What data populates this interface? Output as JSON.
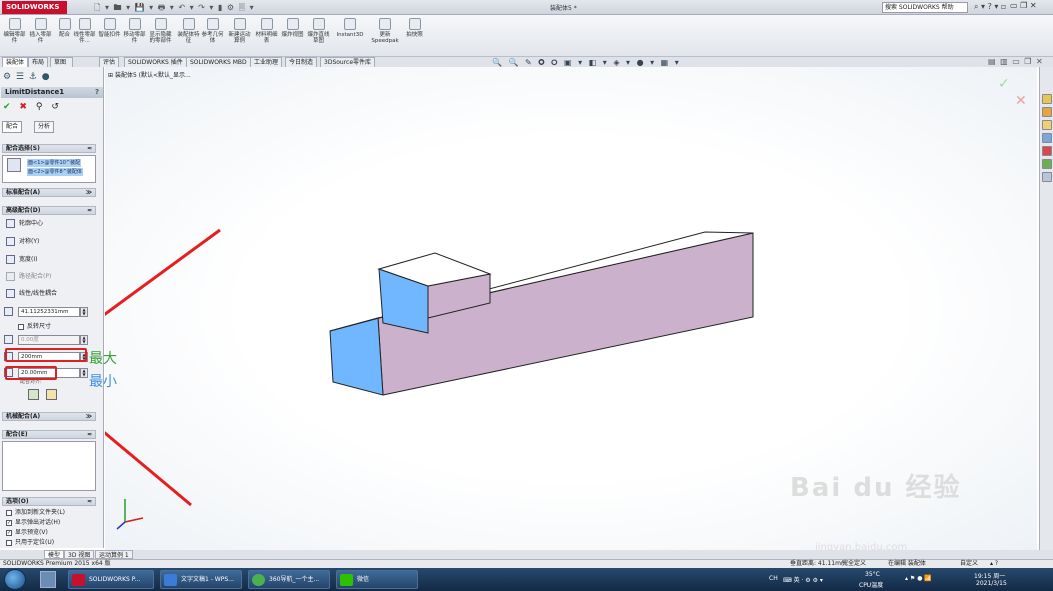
{
  "app": {
    "brand": "SOLIDWORKS",
    "document_title": "装配体5 *",
    "help_search": "搜索 SOLIDWORKS 帮助",
    "quick_access_glyphs": "🗋 ▾ 🖿 ▾ 💾 ▾ 🖶 ▾ ↶ ▾ ↷ ▾ ▮ ⚙ 🗏 ▾",
    "help_glyphs": "⌕ ▾ ? ▾ ▫",
    "window_glyphs": "▭ ❐ ✕"
  },
  "commandmanager": [
    {
      "label": "编辑零部件"
    },
    {
      "label": "插入零部件"
    },
    {
      "label": "配合"
    },
    {
      "label": "线性零部件..."
    },
    {
      "label": "智能扣件"
    },
    {
      "label": "移动零部件"
    },
    {
      "label": "显示隐藏的零部件"
    },
    {
      "label": "装配体特征"
    },
    {
      "label": "参考几何体"
    },
    {
      "label": "新建运动算例"
    },
    {
      "label": "材料明细表"
    },
    {
      "label": "爆炸视图"
    },
    {
      "label": "爆炸直线草图"
    },
    {
      "label": "Instant3D"
    },
    {
      "label": "更新Speedpak"
    },
    {
      "label": "拍快照"
    }
  ],
  "tabs": [
    "装配体",
    "布局",
    "草图",
    "评估",
    "SOLIDWORKS 插件",
    "SOLIDWORKS MBD",
    "工业助理",
    "今日制造",
    "3DSource零件库"
  ],
  "view_toolbar_glyphs": "🔍 🔍 ✎ 🞉 🞇 ▣ ▾ ◧ ▾ ◈ ▾ ● ▾ ▦ ▾",
  "view_corner_glyphs": "▤ ▥ ▭ ❐ ✕",
  "property_manager": {
    "panel_tab_glyphs": "⚙ ☰ ⚓ ●",
    "title": "LimitDistance1",
    "help_glyph": "?",
    "action_glyphs": {
      "ok": "✔",
      "cancel": "✖",
      "pin": "⚲",
      "undo": "↺"
    },
    "sub_tabs": [
      "配合",
      "分析"
    ],
    "mate_selections_header": "配合选择(S)",
    "selections": [
      "面<1>@零件10^装配",
      "面<2>@零件8^装配体"
    ],
    "standard_mates_header": "标准配合(A)",
    "advanced_mates_header": "高级配合(D)",
    "advanced_mates": [
      "轮廓中心",
      "对称(Y)",
      "宽度(I)",
      "路径配合(P)",
      "线性/线性耦合"
    ],
    "distance_value": "41.11252331mm",
    "flip_dimension_label": "反转尺寸",
    "angle_value": "0.00度",
    "max_value": "200mm",
    "min_value": "20.00mm",
    "mate_alignment_label": "配合对齐:",
    "mechanical_mates_header": "机械配合(A)",
    "mates_header": "配合(E)",
    "options_header": "选项(O)",
    "options": [
      {
        "label": "添加到新文件夹(L)",
        "checked": false
      },
      {
        "label": "显示弹出对话(H)",
        "checked": true
      },
      {
        "label": "显示预览(V)",
        "checked": true
      },
      {
        "label": "只用于定位(U)",
        "checked": false
      }
    ]
  },
  "annotations": {
    "max_label": "最大",
    "min_label": "最小"
  },
  "feature_tree_root": "装配体5 (默认<默认_显示...",
  "bottom_tabs": [
    "模型",
    "3D 视图",
    "运动算例 1"
  ],
  "status": {
    "left": "SOLIDWORKS Premium 2015 x64 版",
    "distance": "垂直距离: 41.11mm",
    "defined": "完全定义",
    "editing": "在编辑 装配体",
    "units": "自定义",
    "tray_glyphs": "▴ ?"
  },
  "taskbar": {
    "items": [
      {
        "label": "SOLIDWORKS P...",
        "color": "#c8102e"
      },
      {
        "label": "文字文稿1 - WPS...",
        "color": "#3d7bd9"
      },
      {
        "label": "360导航_一个主...",
        "color": "#4caf50"
      },
      {
        "label": "微信",
        "color": "#2dc100"
      }
    ],
    "lang": "CH",
    "ime_glyphs": "⌨ 英 · ⚙ ⚙ ▾",
    "tray_status_glyphs": "▴ ⚑ ● 📶",
    "temperature": "35°C",
    "temperature_label": "CPU温度",
    "time": "19:15 周一",
    "date": "2021/3/15"
  },
  "watermark": "Bai du 经验",
  "watermark_url": "jingyan.baidu.com"
}
